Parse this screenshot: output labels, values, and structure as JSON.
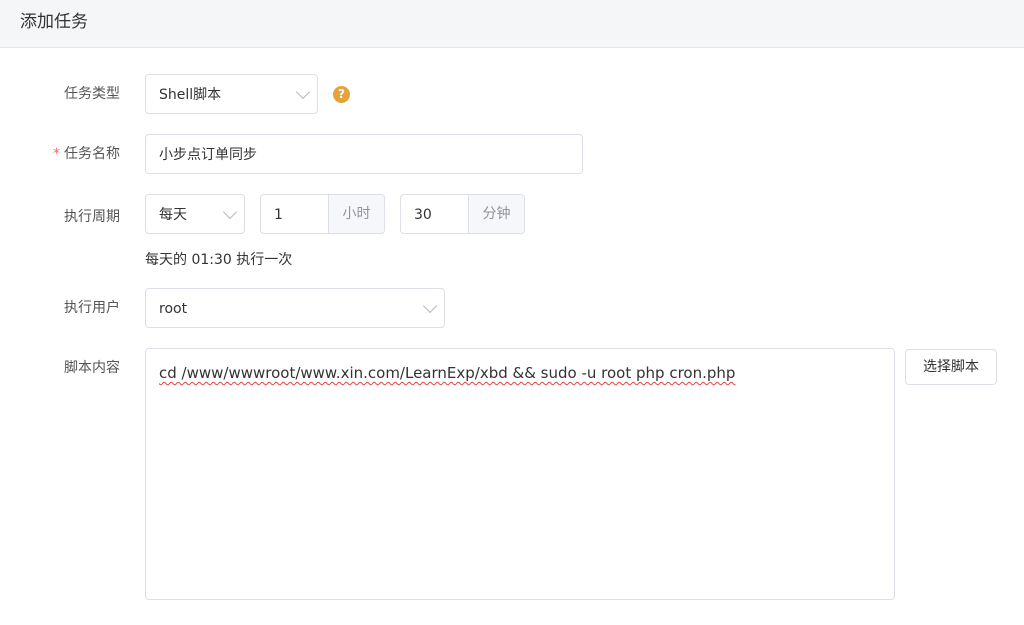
{
  "header": {
    "title": "添加任务"
  },
  "form": {
    "task_type": {
      "label": "任务类型",
      "value": "Shell脚本",
      "help_icon": "question-circle-icon"
    },
    "task_name": {
      "label": "任务名称",
      "required_mark": "*",
      "value": "小步点订单同步"
    },
    "period": {
      "label": "执行周期",
      "frequency": "每天",
      "hours_value": "1",
      "hours_unit": "小时",
      "minutes_value": "30",
      "minutes_unit": "分钟",
      "summary": "每天的 01:30 执行一次"
    },
    "user": {
      "label": "执行用户",
      "value": "root"
    },
    "script": {
      "label": "脚本内容",
      "value": "cd /www/wwwroot/www.xin.com/LearnExp/xbd && sudo -u root php cron.php",
      "choose_button": "选择脚本"
    }
  },
  "colors": {
    "required": "#f56c6c",
    "help_icon": "#e6a23c",
    "header_bg": "#f5f6f7"
  }
}
